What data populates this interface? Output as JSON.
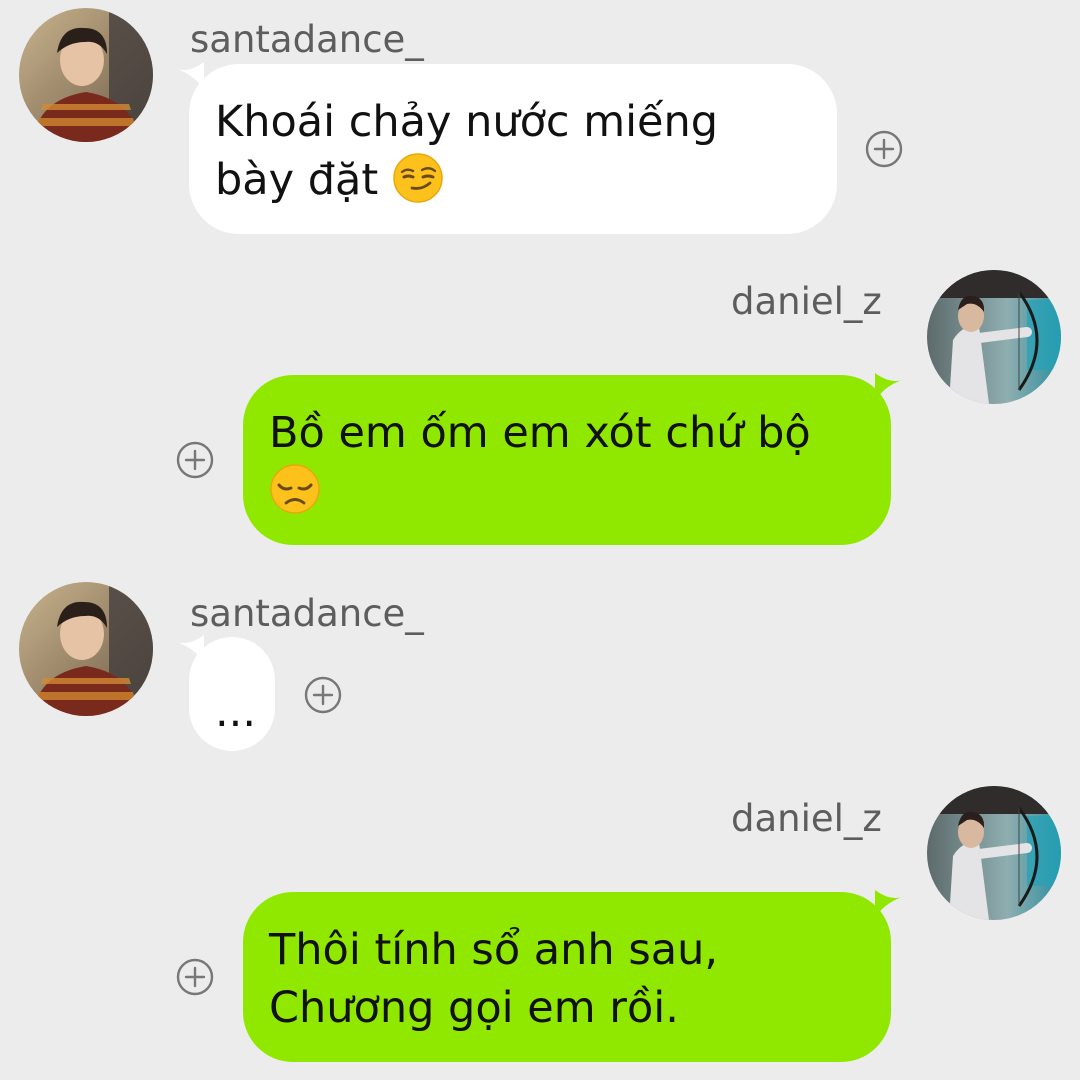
{
  "messages": [
    {
      "sender": "santadance_",
      "direction": "incoming",
      "text": "Khoái chảy nước miếng bày đặt",
      "emoji": "smirking-face-emoji"
    },
    {
      "sender": "daniel_z",
      "direction": "outgoing",
      "text": "Bồ em ốm em xót chứ bộ",
      "emoji": "disappointed-face-emoji"
    },
    {
      "sender": "santadance_",
      "direction": "incoming",
      "text": "..."
    },
    {
      "sender": "daniel_z",
      "direction": "outgoing",
      "line1": "Thôi tính sổ anh sau,",
      "line2": "Chương gọi em rồi."
    }
  ],
  "icons": {
    "add": "plus-circle-icon"
  },
  "colors": {
    "background": "#ececec",
    "incoming_bubble": "#ffffff",
    "outgoing_bubble": "#90e800",
    "username_text": "#5d5d5d",
    "message_text": "#111111"
  }
}
